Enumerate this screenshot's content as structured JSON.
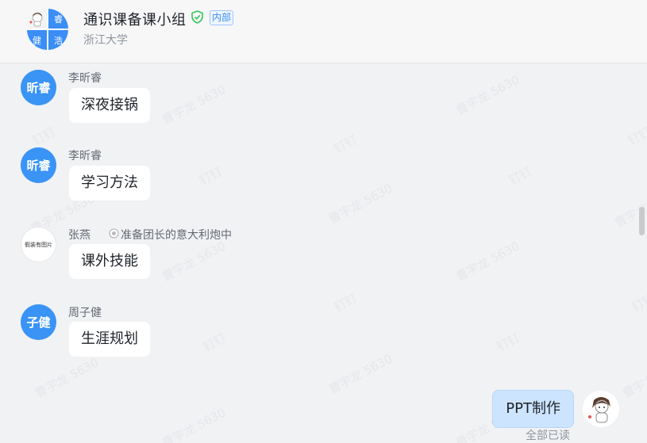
{
  "header": {
    "group_name": "通识课备课小组",
    "badge": "内部",
    "organization": "浙江大学",
    "avatar_cells": [
      "",
      "睿",
      "健",
      "浩"
    ]
  },
  "watermark": {
    "text": "曹宇龙 5630",
    "brand": "钉钉"
  },
  "messages": [
    {
      "sender": "李昕睿",
      "avatar_text": "昕睿",
      "text": "深夜接锅"
    },
    {
      "sender": "李昕睿",
      "avatar_text": "昕睿",
      "text": "学习方法"
    },
    {
      "sender": "张燕",
      "avatar_text": "假装有图片",
      "status": "准备团长的意大利炮中",
      "text": "课外技能"
    },
    {
      "sender": "周子健",
      "avatar_text": "子健",
      "text": "生涯规划"
    }
  ],
  "self_message": {
    "text": "PPT制作",
    "read_status": "全部已读"
  },
  "colors": {
    "avatar_blue": "#3a94f6",
    "self_bubble": "#cde4ff",
    "background": "#f1f2f4"
  }
}
